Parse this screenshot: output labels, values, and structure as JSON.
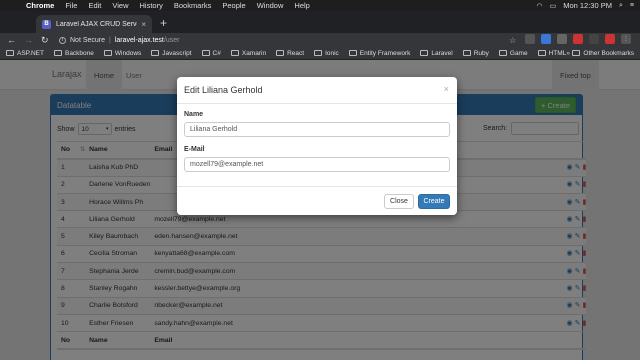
{
  "menubar": {
    "items": [
      "Chrome",
      "File",
      "Edit",
      "View",
      "History",
      "Bookmarks",
      "People",
      "Window",
      "Help"
    ],
    "clock": "Mon 12:30 PM"
  },
  "browser": {
    "tab_title": "Laravel AJAX CRUD Server Si",
    "tab_favicon": "B",
    "security": "Not Secure",
    "url_host": "laravel-ajax.test",
    "url_path": "/user",
    "bookmarks": [
      "ASP.NET",
      "Backbone",
      "Windows",
      "Javascript",
      "C#",
      "Xamarin",
      "React",
      "Ionic",
      "Entity Framework",
      "Laravel",
      "Ruby",
      "Game",
      "HTML"
    ],
    "other_bookmarks": "Other Bookmarks",
    "more": "»"
  },
  "app": {
    "brand": "Larajax",
    "nav": [
      "Home",
      "User"
    ],
    "nav_right": "Fixed top"
  },
  "panel": {
    "title": "Datatable",
    "create_label": "+ Create",
    "show_label": "Show",
    "show_value": "10",
    "entries_label": "entries",
    "search_label": "Search:"
  },
  "table": {
    "headers": [
      "No",
      "Name",
      "Email",
      ""
    ],
    "rows": [
      {
        "no": "1",
        "name": "Laisha Kub PhD",
        "email": ""
      },
      {
        "no": "2",
        "name": "Darlene VonRueden",
        "email": ""
      },
      {
        "no": "3",
        "name": "Horace Willms Ph",
        "email": ""
      },
      {
        "no": "4",
        "name": "Liliana Gerhold",
        "email": "mozell79@example.net"
      },
      {
        "no": "5",
        "name": "Kiley Baumbach",
        "email": "eden.hansen@example.net"
      },
      {
        "no": "6",
        "name": "Cecilia Stroman",
        "email": "kenyatta68@example.com"
      },
      {
        "no": "7",
        "name": "Stephania Jerde",
        "email": "cremin.bud@example.com"
      },
      {
        "no": "8",
        "name": "Stanley Rogahn",
        "email": "kessler.bettye@example.org"
      },
      {
        "no": "9",
        "name": "Charlie Botsford",
        "email": "nbecker@example.net"
      },
      {
        "no": "10",
        "name": "Esther Friesen",
        "email": "sandy.hahn@example.net"
      }
    ],
    "footer": [
      "No",
      "Name",
      "Email"
    ]
  },
  "modal": {
    "title": "Edit Liliana Gerhold",
    "close_icon": "×",
    "name_label": "Name",
    "name_value": "Liliana Gerhold",
    "email_label": "E-Mail",
    "email_value": "mozell79@example.net",
    "close_button": "Close",
    "create_button": "Create"
  },
  "colors": {
    "primary": "#337ab7",
    "success": "#5cb85c",
    "danger": "#d9534f"
  }
}
